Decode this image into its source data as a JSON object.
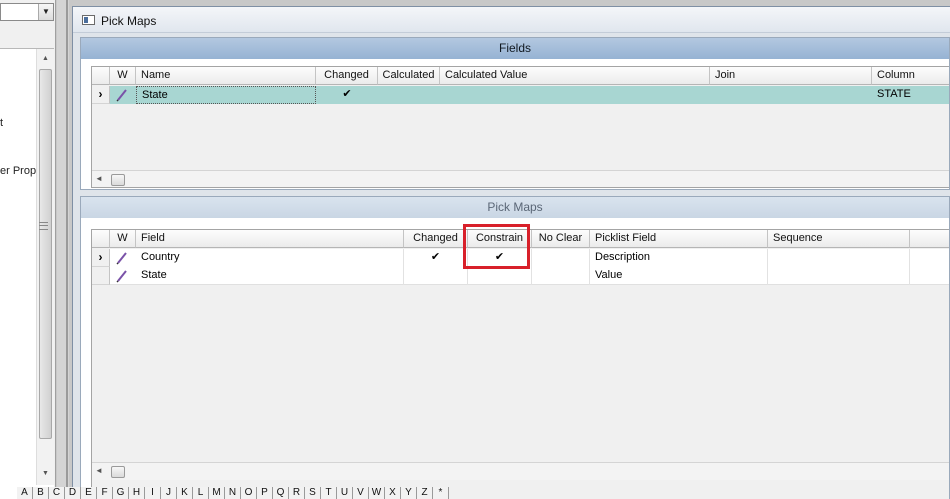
{
  "left_panel": {
    "tree_items": [
      "t",
      "er Prop"
    ]
  },
  "window": {
    "title": "Pick Maps"
  },
  "fields_section": {
    "header": "Fields",
    "columns": [
      "W",
      "Name",
      "Changed",
      "Calculated",
      "Calculated Value",
      "Join",
      "Column"
    ],
    "rows": [
      {
        "name": "State",
        "changed": "✔",
        "calculated": "",
        "calculated_value": "",
        "join": "",
        "column": "STATE"
      }
    ]
  },
  "pickmaps_section": {
    "header": "Pick Maps",
    "columns": [
      "W",
      "Field",
      "Changed",
      "Constrain",
      "No Clear",
      "Picklist Field",
      "Sequence"
    ],
    "rows": [
      {
        "field": "Country",
        "changed": "✔",
        "constrain": "✔",
        "no_clear": "",
        "picklist_field": "Description",
        "sequence": ""
      },
      {
        "field": "State",
        "changed": "",
        "constrain": "",
        "no_clear": "",
        "picklist_field": "Value",
        "sequence": ""
      }
    ]
  },
  "alphabet": [
    "A",
    "B",
    "C",
    "D",
    "E",
    "F",
    "G",
    "H",
    "I",
    "J",
    "K",
    "L",
    "M",
    "N",
    "O",
    "P",
    "Q",
    "R",
    "S",
    "T",
    "U",
    "V",
    "W",
    "X",
    "Y",
    "Z",
    "*"
  ],
  "colors": {
    "selected_row": "#a8d6d2",
    "fields_header": "#96b3d3",
    "highlight_box": "#d8202a",
    "window_border": "#7f8fa4"
  },
  "icons": {
    "row_selector": "chevron-right-icon",
    "edit": "pencil-icon",
    "window": "window-icon"
  }
}
